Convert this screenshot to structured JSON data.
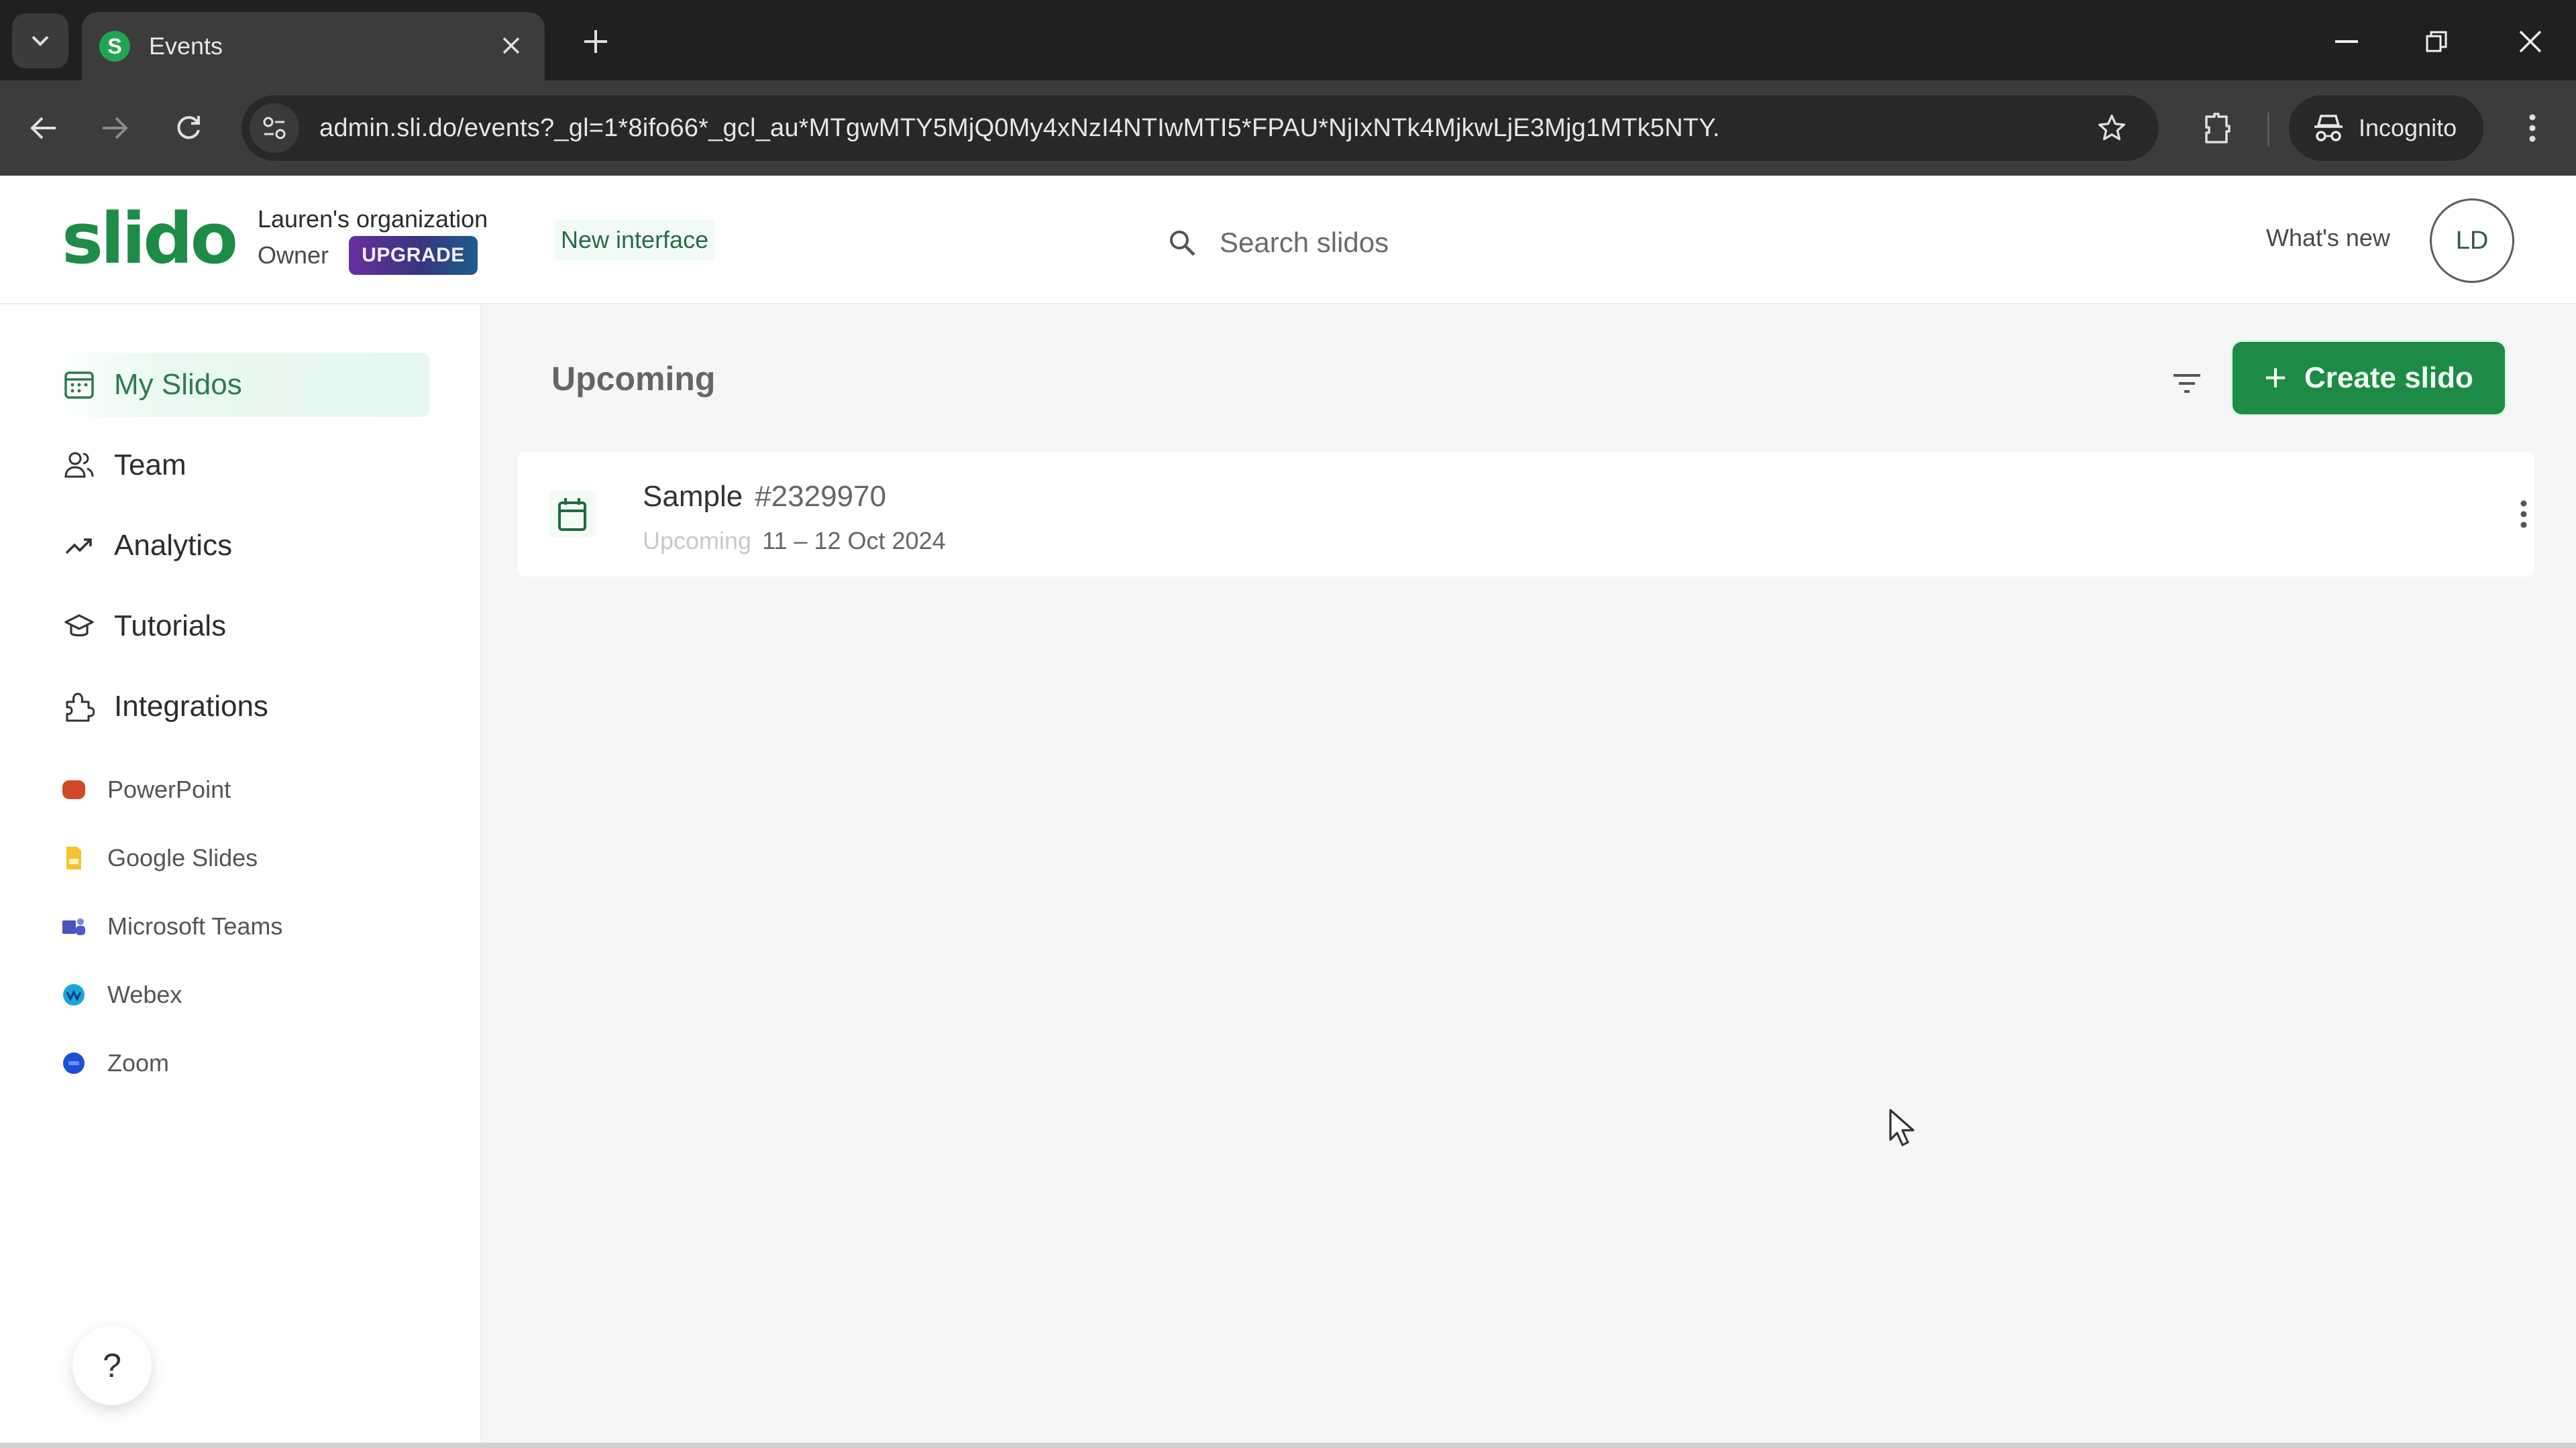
{
  "browser": {
    "tab": {
      "title": "Events",
      "favicon_letter": "S",
      "favicon_color": "#22a352"
    },
    "url": "admin.sli.do/events?_gl=1*8ifo66*_gcl_au*MTgwMTY5MjQ0My4xNzI4NTIwMTI5*FPAU*NjIxNTk4MjkwLjE3Mjg1MTk5NTY.",
    "incognito_label": "Incognito",
    "icons": {
      "tab_search": "chevron-down-icon",
      "close_tab": "close-icon",
      "new_tab": "plus-icon",
      "minimize": "minimize-icon",
      "restore": "restore-icon",
      "close_window": "close-icon",
      "back": "arrow-left-icon",
      "forward": "arrow-right-icon",
      "reload": "reload-icon",
      "site_info": "tune-icon",
      "bookmark": "star-icon",
      "extensions": "puzzle-icon",
      "incognito": "incognito-icon",
      "menu": "kebab-icon"
    }
  },
  "header": {
    "logo": "slido",
    "org_name": "Lauren's organization",
    "role": "Owner",
    "upgrade_label": "UPGRADE",
    "new_interface_label": "New interface",
    "search_placeholder": "Search slidos",
    "search_value": "",
    "whats_new_label": "What's new",
    "avatar_initials": "LD"
  },
  "sidebar": {
    "items": [
      {
        "label": "My Slidos",
        "icon": "calendar-grid-icon",
        "active": true
      },
      {
        "label": "Team",
        "icon": "team-icon",
        "active": false
      },
      {
        "label": "Analytics",
        "icon": "trend-up-icon",
        "active": false
      },
      {
        "label": "Tutorials",
        "icon": "graduation-cap-icon",
        "active": false
      },
      {
        "label": "Integrations",
        "icon": "puzzle-icon",
        "active": false
      }
    ],
    "integrations": [
      {
        "label": "PowerPoint",
        "icon": "powerpoint-icon",
        "color": "#d04a2a"
      },
      {
        "label": "Google Slides",
        "icon": "google-slides-icon",
        "color": "#f4c430"
      },
      {
        "label": "Microsoft Teams",
        "icon": "microsoft-teams-icon",
        "color": "#5059c9"
      },
      {
        "label": "Webex",
        "icon": "webex-icon",
        "color": "#1aa6d6"
      },
      {
        "label": "Zoom",
        "icon": "zoom-icon",
        "color": "#1d4fd8"
      }
    ],
    "help_label": "?"
  },
  "main": {
    "section_title": "Upcoming",
    "create_label": "Create slido",
    "events": [
      {
        "name": "Sample",
        "code": "#2329970",
        "status": "Upcoming",
        "dates": "11 – 12 Oct 2024"
      }
    ]
  },
  "colors": {
    "brand_green": "#1d8a46",
    "active_nav_bg": "#e6f8ef",
    "upgrade_gradient_start": "#6a2f9e",
    "upgrade_gradient_end": "#1d5d8c"
  }
}
